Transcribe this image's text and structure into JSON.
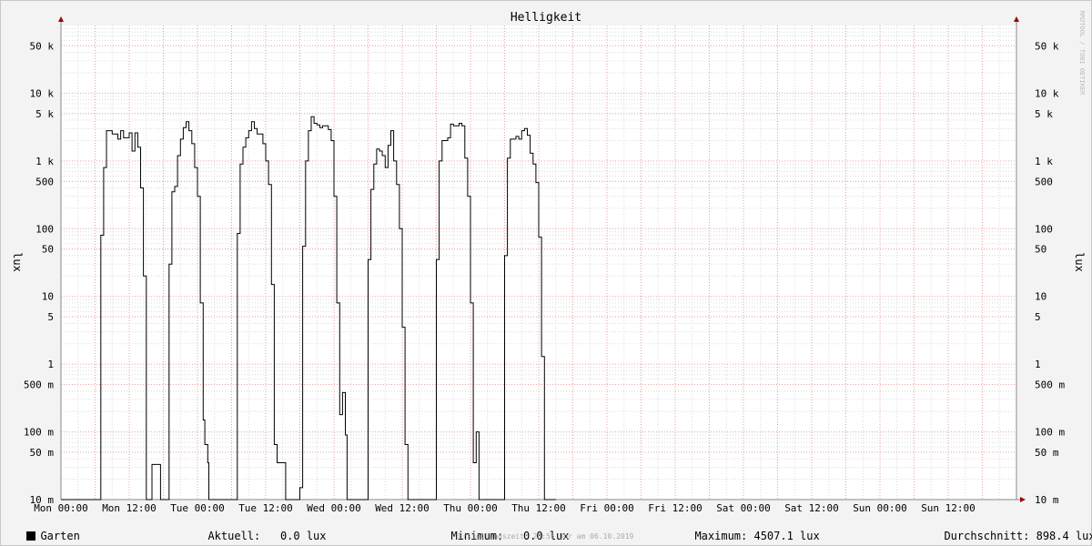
{
  "chart_data": {
    "type": "line",
    "title": "Helligkeit",
    "ylabel": "lux",
    "scale": "log",
    "ylim": [
      0.01,
      100000
    ],
    "y_ticks": [
      {
        "value": 50000,
        "label": "50 k"
      },
      {
        "value": 10000,
        "label": "10 k"
      },
      {
        "value": 5000,
        "label": "5 k"
      },
      {
        "value": 1000,
        "label": "1 k"
      },
      {
        "value": 500,
        "label": "500"
      },
      {
        "value": 100,
        "label": "100"
      },
      {
        "value": 50,
        "label": "50"
      },
      {
        "value": 10,
        "label": "10"
      },
      {
        "value": 5,
        "label": "5"
      },
      {
        "value": 1,
        "label": "1"
      },
      {
        "value": 0.5,
        "label": "500 m"
      },
      {
        "value": 0.1,
        "label": "100 m"
      },
      {
        "value": 0.05,
        "label": "50 m"
      },
      {
        "value": 0.01,
        "label": "10 m"
      }
    ],
    "x_unit": "hours since Mon 00:00",
    "xlim": [
      0,
      168
    ],
    "x_ticks": [
      {
        "value": 0,
        "label": "Mon 00:00"
      },
      {
        "value": 12,
        "label": "Mon 12:00"
      },
      {
        "value": 24,
        "label": "Tue 00:00"
      },
      {
        "value": 36,
        "label": "Tue 12:00"
      },
      {
        "value": 48,
        "label": "Wed 00:00"
      },
      {
        "value": 60,
        "label": "Wed 12:00"
      },
      {
        "value": 72,
        "label": "Thu 00:00"
      },
      {
        "value": 84,
        "label": "Thu 12:00"
      },
      {
        "value": 96,
        "label": "Fri 00:00"
      },
      {
        "value": 108,
        "label": "Fri 12:00"
      },
      {
        "value": 120,
        "label": "Sat 00:00"
      },
      {
        "value": 132,
        "label": "Sat 12:00"
      },
      {
        "value": 144,
        "label": "Sun 00:00"
      },
      {
        "value": 156,
        "label": "Sun 12:00"
      }
    ],
    "grid": true,
    "series": [
      {
        "name": "Garten",
        "color": "#000000",
        "points": [
          [
            0,
            0.01
          ],
          [
            7,
            0.01
          ],
          [
            7,
            80
          ],
          [
            7.5,
            80
          ],
          [
            7.5,
            800
          ],
          [
            8,
            800
          ],
          [
            8,
            2800
          ],
          [
            9,
            2800
          ],
          [
            9,
            2500
          ],
          [
            10,
            2500
          ],
          [
            10,
            2100
          ],
          [
            10.5,
            2100
          ],
          [
            10.5,
            2800
          ],
          [
            11,
            2800
          ],
          [
            11,
            2200
          ],
          [
            12,
            2200
          ],
          [
            12,
            2600
          ],
          [
            12.5,
            2600
          ],
          [
            12.5,
            1400
          ],
          [
            13,
            1400
          ],
          [
            13,
            2600
          ],
          [
            13.5,
            2600
          ],
          [
            13.5,
            1600
          ],
          [
            14,
            1600
          ],
          [
            14,
            400
          ],
          [
            14.5,
            400
          ],
          [
            14.5,
            20
          ],
          [
            15,
            20
          ],
          [
            15,
            0.01
          ],
          [
            16,
            0.01
          ],
          [
            16,
            0.033
          ],
          [
            17.5,
            0.033
          ],
          [
            17.5,
            0.01
          ],
          [
            19,
            0.01
          ],
          [
            19,
            30
          ],
          [
            19.5,
            30
          ],
          [
            19.5,
            350
          ],
          [
            20,
            350
          ],
          [
            20,
            420
          ],
          [
            20.5,
            420
          ],
          [
            20.5,
            1200
          ],
          [
            21,
            1200
          ],
          [
            21,
            2100
          ],
          [
            21.5,
            2100
          ],
          [
            21.5,
            3100
          ],
          [
            22,
            3100
          ],
          [
            22,
            3800
          ],
          [
            22.5,
            3800
          ],
          [
            22.5,
            2800
          ],
          [
            23,
            2800
          ],
          [
            23,
            1800
          ],
          [
            23.5,
            1800
          ],
          [
            23.5,
            800
          ],
          [
            24,
            800
          ],
          [
            24,
            300
          ],
          [
            24.5,
            300
          ],
          [
            24.5,
            8
          ],
          [
            25,
            8
          ],
          [
            25,
            0.15
          ],
          [
            25.3,
            0.15
          ],
          [
            25.3,
            0.065
          ],
          [
            25.8,
            0.065
          ],
          [
            25.8,
            0.035
          ],
          [
            26,
            0.035
          ],
          [
            26,
            0.01
          ],
          [
            31,
            0.01
          ],
          [
            31,
            85
          ],
          [
            31.5,
            85
          ],
          [
            31.5,
            900
          ],
          [
            32,
            900
          ],
          [
            32,
            1600
          ],
          [
            32.5,
            1600
          ],
          [
            32.5,
            2200
          ],
          [
            33,
            2200
          ],
          [
            33,
            2800
          ],
          [
            33.5,
            2800
          ],
          [
            33.5,
            3800
          ],
          [
            34,
            3800
          ],
          [
            34,
            3000
          ],
          [
            34.5,
            3000
          ],
          [
            34.5,
            2500
          ],
          [
            35.5,
            2500
          ],
          [
            35.5,
            1800
          ],
          [
            36,
            1800
          ],
          [
            36,
            1000
          ],
          [
            36.5,
            1000
          ],
          [
            36.5,
            450
          ],
          [
            37,
            450
          ],
          [
            37,
            15
          ],
          [
            37.5,
            15
          ],
          [
            37.5,
            0.065
          ],
          [
            38,
            0.065
          ],
          [
            38,
            0.035
          ],
          [
            39.5,
            0.035
          ],
          [
            39.5,
            0.01
          ],
          [
            42,
            0.01
          ],
          [
            42,
            0.015
          ],
          [
            42.5,
            0.015
          ],
          [
            42.5,
            55
          ],
          [
            43,
            55
          ],
          [
            43,
            1000
          ],
          [
            43.5,
            1000
          ],
          [
            43.5,
            2800
          ],
          [
            44,
            2800
          ],
          [
            44,
            4500
          ],
          [
            44.5,
            4500
          ],
          [
            44.5,
            3600
          ],
          [
            45,
            3600
          ],
          [
            45,
            3400
          ],
          [
            45.5,
            3400
          ],
          [
            45.5,
            3100
          ],
          [
            46,
            3100
          ],
          [
            46,
            3300
          ],
          [
            47,
            3300
          ],
          [
            47,
            2900
          ],
          [
            47.5,
            2900
          ],
          [
            47.5,
            2000
          ],
          [
            48,
            2000
          ],
          [
            48,
            300
          ],
          [
            48.5,
            300
          ],
          [
            48.5,
            8
          ],
          [
            49,
            8
          ],
          [
            49,
            0.18
          ],
          [
            49.5,
            0.18
          ],
          [
            49.5,
            0.38
          ],
          [
            50,
            0.38
          ],
          [
            50,
            0.09
          ],
          [
            50.3,
            0.09
          ],
          [
            50.3,
            0.01
          ],
          [
            54,
            0.01
          ],
          [
            54,
            35
          ],
          [
            54.5,
            35
          ],
          [
            54.5,
            380
          ],
          [
            55,
            380
          ],
          [
            55,
            900
          ],
          [
            55.5,
            900
          ],
          [
            55.5,
            1500
          ],
          [
            56,
            1500
          ],
          [
            56,
            1400
          ],
          [
            56.5,
            1400
          ],
          [
            56.5,
            1200
          ],
          [
            57,
            1200
          ],
          [
            57,
            800
          ],
          [
            57.5,
            800
          ],
          [
            57.5,
            1700
          ],
          [
            58,
            1700
          ],
          [
            58,
            2800
          ],
          [
            58.5,
            2800
          ],
          [
            58.5,
            1000
          ],
          [
            59,
            1000
          ],
          [
            59,
            450
          ],
          [
            59.5,
            450
          ],
          [
            59.5,
            100
          ],
          [
            60,
            100
          ],
          [
            60,
            3.5
          ],
          [
            60.5,
            3.5
          ],
          [
            60.5,
            0.065
          ],
          [
            61,
            0.065
          ],
          [
            61,
            0.01
          ],
          [
            66,
            0.01
          ],
          [
            66,
            35
          ],
          [
            66.5,
            35
          ],
          [
            66.5,
            1000
          ],
          [
            67,
            1000
          ],
          [
            67,
            2000
          ],
          [
            68,
            2000
          ],
          [
            68,
            2200
          ],
          [
            68.5,
            2200
          ],
          [
            68.5,
            3500
          ],
          [
            69,
            3500
          ],
          [
            69,
            3300
          ],
          [
            70,
            3300
          ],
          [
            70,
            3600
          ],
          [
            70.5,
            3600
          ],
          [
            70.5,
            3300
          ],
          [
            71,
            3300
          ],
          [
            71,
            1100
          ],
          [
            71.5,
            1100
          ],
          [
            71.5,
            300
          ],
          [
            72,
            300
          ],
          [
            72,
            8
          ],
          [
            72.5,
            8
          ],
          [
            72.5,
            0.035
          ],
          [
            73,
            0.035
          ],
          [
            73,
            0.1
          ],
          [
            73.5,
            0.1
          ],
          [
            73.5,
            0.01
          ],
          [
            78,
            0.01
          ],
          [
            78,
            40
          ],
          [
            78.5,
            40
          ],
          [
            78.5,
            1100
          ],
          [
            79,
            1100
          ],
          [
            79,
            2100
          ],
          [
            80,
            2100
          ],
          [
            80,
            2300
          ],
          [
            80.5,
            2300
          ],
          [
            80.5,
            2100
          ],
          [
            81,
            2100
          ],
          [
            81,
            2800
          ],
          [
            81.5,
            2800
          ],
          [
            81.5,
            3000
          ],
          [
            82,
            3000
          ],
          [
            82,
            2400
          ],
          [
            82.5,
            2400
          ],
          [
            82.5,
            1300
          ],
          [
            83,
            1300
          ],
          [
            83,
            900
          ],
          [
            83.5,
            900
          ],
          [
            83.5,
            480
          ],
          [
            84,
            480
          ],
          [
            84,
            75
          ],
          [
            84.5,
            75
          ],
          [
            84.5,
            1.3
          ],
          [
            85,
            1.3
          ],
          [
            85,
            0.01
          ],
          [
            87,
            0.01
          ]
        ]
      }
    ]
  },
  "legend": {
    "series_label": "Garten",
    "current_label": "Aktuell:",
    "current_value": "0.0 lux",
    "min_label": "Minimum:",
    "min_value": "0.0 lux",
    "max_label": "Maximum:",
    "max_value": "4507.1 lux",
    "avg_label": "Durchschnitt:",
    "avg_value": "898.4 lux"
  },
  "watermark": "RRDTOOL / TOBI OETIKER",
  "footer": "Erstellungszeit: 23:55 Uhr am 06.10.2019",
  "colors": {
    "background": "#f3f3f3",
    "plot_background": "#ffffff",
    "minor_grid": "#dcdcdc",
    "major_grid": "#e8a0a0",
    "line": "#000000",
    "axis_arrow": "#a00000"
  }
}
